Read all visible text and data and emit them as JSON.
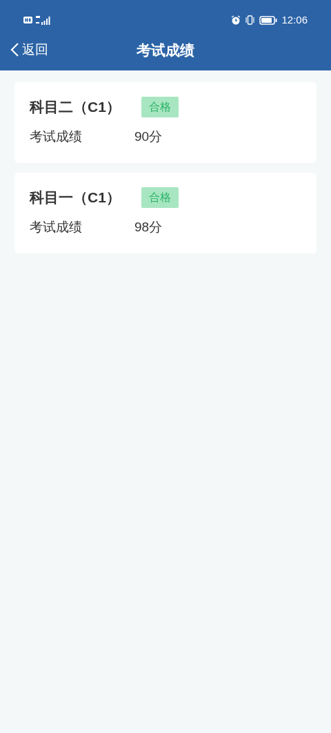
{
  "status_bar": {
    "time": "12:06"
  },
  "header": {
    "back_label": "返回",
    "title": "考试成绩"
  },
  "results": [
    {
      "subject": "科目二（C1）",
      "badge": "合格",
      "score_label": "考试成绩",
      "score": "90分"
    },
    {
      "subject": "科目一（C1）",
      "badge": "合格",
      "score_label": "考试成绩",
      "score": "98分"
    }
  ]
}
